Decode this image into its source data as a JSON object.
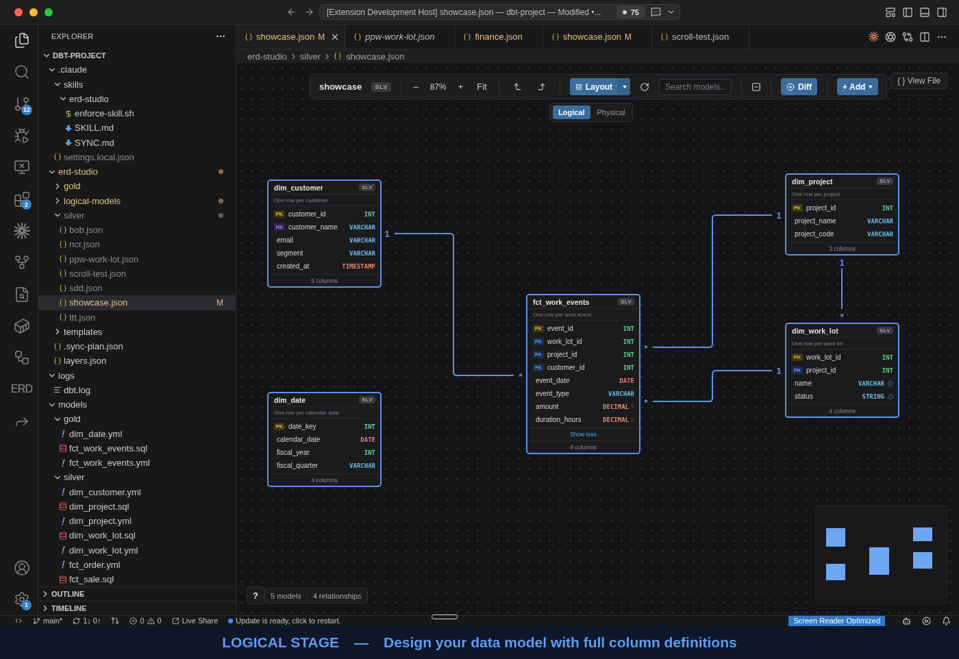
{
  "window": {
    "title": "[Extension Development Host] showcase.json — dbt-project — Modified •...",
    "count": "75"
  },
  "activity_bar": {
    "top": [
      {
        "kind": "files",
        "selected": true
      },
      {
        "kind": "search",
        "selected": false
      },
      {
        "kind": "source_control",
        "selected": false,
        "badge": "12"
      },
      {
        "kind": "run_debug",
        "selected": false
      },
      {
        "kind": "remote",
        "selected": false
      },
      {
        "kind": "extensions",
        "selected": false,
        "badge": "2"
      },
      {
        "kind": "starburst",
        "selected": false
      },
      {
        "kind": "git_graph",
        "selected": false
      },
      {
        "kind": "file_search",
        "selected": false
      },
      {
        "kind": "container",
        "selected": false
      },
      {
        "kind": "diagram",
        "selected": false
      },
      {
        "kind": "text",
        "label": "ERD",
        "selected": false
      },
      {
        "kind": "share",
        "selected": false
      }
    ],
    "bottom": [
      {
        "kind": "account",
        "selected": false
      },
      {
        "kind": "settings",
        "selected": false,
        "badge": "1"
      }
    ]
  },
  "sidebar": {
    "title": "EXPLORER",
    "tree": [
      {
        "label": "DBT-PROJECT",
        "kind": "root",
        "expanded": true,
        "selected": false,
        "children": [
          {
            "label": ".claude",
            "kind": "folder",
            "expanded": true,
            "selected": false,
            "children": [
              {
                "label": "skills",
                "kind": "folder",
                "expanded": true,
                "selected": false,
                "children": [
                  {
                    "label": "erd-studio",
                    "kind": "folder",
                    "expanded": true,
                    "selected": false,
                    "children": [
                      {
                        "label": "enforce-skill.sh",
                        "kind": "shell",
                        "selected": false
                      },
                      {
                        "label": "SKILL.md",
                        "kind": "markdown",
                        "selected": false
                      },
                      {
                        "label": "SYNC.md",
                        "kind": "markdown",
                        "selected": false
                      }
                    ]
                  }
                ]
              },
              {
                "label": "settings.local.json",
                "kind": "json",
                "color": "#8c8c8c",
                "selected": false
              }
            ]
          },
          {
            "label": "erd-studio",
            "kind": "folder",
            "expanded": true,
            "color": "#e2c08d",
            "dot": {
              "color": "#8a6a4c"
            },
            "selected": false,
            "children": [
              {
                "label": "gold",
                "kind": "folder",
                "expanded": false,
                "color": "#e2c08d",
                "selected": false
              },
              {
                "label": "logical-models",
                "kind": "folder",
                "expanded": false,
                "color": "#e2c08d",
                "dot": {
                  "color": "#8a6a4c"
                },
                "selected": false
              },
              {
                "label": "silver",
                "kind": "folder",
                "expanded": true,
                "color": "#8c8c8c",
                "dot": {
                  "color": "#5e5e5e"
                },
                "selected": false,
                "children": [
                  {
                    "label": "bob.json",
                    "kind": "json",
                    "color": "#8c8c8c",
                    "selected": false
                  },
                  {
                    "label": "ncr.json",
                    "kind": "json",
                    "color": "#8c8c8c",
                    "selected": false
                  },
                  {
                    "label": "ppw-work-lot.json",
                    "kind": "json",
                    "color": "#8c8c8c",
                    "selected": false
                  },
                  {
                    "label": "scroll-test.json",
                    "kind": "json",
                    "color": "#8c8c8c",
                    "selected": false
                  },
                  {
                    "label": "sdd.json",
                    "kind": "json",
                    "color": "#8c8c8c",
                    "selected": false
                  },
                  {
                    "label": "showcase.json",
                    "kind": "json",
                    "color": "#e2c08d",
                    "badge": "M",
                    "selected": true
                  },
                  {
                    "label": "ttt.json",
                    "kind": "json",
                    "color": "#8c8c8c",
                    "selected": false
                  }
                ]
              },
              {
                "label": "templates",
                "kind": "folder",
                "expanded": false,
                "selected": false
              },
              {
                "label": ".sync-plan.json",
                "kind": "json",
                "selected": false
              },
              {
                "label": "layers.json",
                "kind": "json",
                "selected": false
              }
            ]
          },
          {
            "label": "logs",
            "kind": "folder",
            "expanded": true,
            "selected": false,
            "children": [
              {
                "label": "dbt.log",
                "kind": "log",
                "selected": false
              }
            ]
          },
          {
            "label": "models",
            "kind": "folder",
            "expanded": true,
            "selected": false,
            "children": [
              {
                "label": "gold",
                "kind": "folder",
                "expanded": true,
                "selected": false,
                "children": [
                  {
                    "label": "dim_date.yml",
                    "kind": "yaml",
                    "selected": false
                  },
                  {
                    "label": "fct_work_events.sql",
                    "kind": "sql",
                    "selected": false
                  },
                  {
                    "label": "fct_work_events.yml",
                    "kind": "yaml",
                    "selected": false
                  }
                ]
              },
              {
                "label": "silver",
                "kind": "folder",
                "expanded": true,
                "selected": false,
                "children": [
                  {
                    "label": "dim_customer.yml",
                    "kind": "yaml",
                    "selected": false
                  },
                  {
                    "label": "dim_project.sql",
                    "kind": "sql",
                    "selected": false
                  },
                  {
                    "label": "dim_project.yml",
                    "kind": "yaml",
                    "selected": false
                  },
                  {
                    "label": "dim_work_lot.sql",
                    "kind": "sql",
                    "selected": false
                  },
                  {
                    "label": "dim_work_lot.yml",
                    "kind": "yaml",
                    "selected": false
                  },
                  {
                    "label": "fct_order.yml",
                    "kind": "yaml",
                    "selected": false
                  },
                  {
                    "label": "fct_sale.sql",
                    "kind": "sql",
                    "selected": false
                  }
                ]
              }
            ]
          }
        ]
      }
    ],
    "sections": [
      {
        "label": "OUTLINE",
        "expanded": false
      },
      {
        "label": "TIMELINE",
        "expanded": false
      }
    ]
  },
  "tabs": [
    {
      "label": "showcase.json",
      "color": "#e2c08d",
      "badge": "M",
      "preview": false,
      "selected": true
    },
    {
      "label": "ppw-work-lot.json",
      "preview": true,
      "selected": false
    },
    {
      "label": "finance.json",
      "color": "#e2c08d",
      "preview": false,
      "selected": false
    },
    {
      "label": "showcase.json",
      "color": "#e2c08d",
      "badge": "M",
      "preview": false,
      "selected": false
    },
    {
      "label": "scroll-test.json",
      "preview": false,
      "selected": false
    }
  ],
  "breadcrumb": [
    "erd-studio",
    "silver",
    "showcase.json"
  ],
  "erd": {
    "toolbar": {
      "model": "showcase",
      "layer": "SLV",
      "zoom_out": "–",
      "zoom": "87%",
      "zoom_in": "+",
      "fit": "Fit",
      "layout": "Layout",
      "search_placeholder": "Search models...",
      "diff": "Diff",
      "add": "+ Add"
    },
    "view_file": "{ } View File",
    "modes": [
      {
        "label": "Logical",
        "selected": true
      },
      {
        "label": "Physical",
        "selected": false
      }
    ],
    "tables": [
      {
        "name": "dim_customer",
        "layer": "SLV",
        "description": "One row per customer",
        "columns": [
          {
            "key": {
              "label": "PK",
              "kind": "primary"
            },
            "name": "customer_id",
            "type": "INT",
            "color": "#5fd08f"
          },
          {
            "key": {
              "label": "NK",
              "kind": "natural"
            },
            "name": "customer_name",
            "type": "VARCHAR",
            "color": "#6cb6dc"
          },
          {
            "name": "email",
            "type": "VARCHAR",
            "color": "#6cb6dc"
          },
          {
            "name": "segment",
            "type": "VARCHAR",
            "color": "#6cb6dc"
          },
          {
            "name": "created_at",
            "type": "TIMESTAMP",
            "color": "#e5846a"
          }
        ],
        "footer": "5 columns"
      },
      {
        "name": "dim_date",
        "layer": "SLV",
        "description": "One row per calendar date",
        "columns": [
          {
            "key": {
              "label": "PK",
              "kind": "primary"
            },
            "name": "date_key",
            "type": "INT",
            "color": "#5fd08f"
          },
          {
            "name": "calendar_date",
            "type": "DATE",
            "color": "#e77b7b"
          },
          {
            "name": "fiscal_year",
            "type": "INT",
            "color": "#5fd08f"
          },
          {
            "name": "fiscal_quarter",
            "type": "VARCHAR",
            "color": "#6cb6dc"
          }
        ],
        "footer": "4 columns"
      },
      {
        "name": "fct_work_events",
        "layer": "SLV",
        "description": "One row per work event",
        "columns": [
          {
            "key": {
              "label": "PK",
              "kind": "primary"
            },
            "name": "event_id",
            "type": "INT",
            "color": "#5fd08f"
          },
          {
            "key": {
              "label": "FK",
              "kind": "foreign"
            },
            "name": "work_lot_id",
            "type": "INT",
            "color": "#5fd08f"
          },
          {
            "key": {
              "label": "FK",
              "kind": "foreign"
            },
            "name": "project_id",
            "type": "INT",
            "color": "#5fd08f"
          },
          {
            "key": {
              "label": "FK",
              "kind": "foreign"
            },
            "name": "customer_id",
            "type": "INT",
            "color": "#5fd08f"
          },
          {
            "name": "event_date",
            "type": "DATE",
            "color": "#e77b7b"
          },
          {
            "name": "event_type",
            "type": "VARCHAR",
            "color": "#6cb6dc"
          },
          {
            "name": "amount",
            "type": "DECIMAL",
            "color": "#e08a6a",
            "suffix": "Σ"
          },
          {
            "name": "duration_hours",
            "type": "DECIMAL",
            "color": "#e08a6a",
            "suffix": "Σ"
          }
        ],
        "toggle": "Show less",
        "footer": "8 columns"
      },
      {
        "name": "dim_project",
        "layer": "SLV",
        "description": "One row per project",
        "columns": [
          {
            "key": {
              "label": "PK",
              "kind": "primary"
            },
            "name": "project_id",
            "type": "INT",
            "color": "#5fd08f"
          },
          {
            "name": "project_name",
            "type": "VARCHAR",
            "color": "#6cb6dc"
          },
          {
            "name": "project_code",
            "type": "VARCHAR",
            "color": "#6cb6dc"
          }
        ],
        "footer": "3 columns"
      },
      {
        "name": "dim_work_lot",
        "layer": "SLV",
        "description": "One row per work lot",
        "columns": [
          {
            "key": {
              "label": "PK",
              "kind": "primary"
            },
            "name": "work_lot_id",
            "type": "INT",
            "color": "#5fd08f"
          },
          {
            "key": {
              "label": "FK",
              "kind": "foreign"
            },
            "name": "project_id",
            "type": "INT",
            "color": "#5fd08f"
          },
          {
            "name": "name",
            "type": "VARCHAR",
            "color": "#6cb6dc",
            "note": true
          },
          {
            "name": "status",
            "type": "STRING",
            "color": "#6cb6dc",
            "note": true
          }
        ],
        "footer": "4 columns"
      }
    ],
    "relationships": [
      {
        "start": "1",
        "end": "*"
      },
      {
        "start": "*",
        "end": "1"
      },
      {
        "start": "*",
        "end": "1"
      },
      {
        "start": "1",
        "end": "*"
      }
    ],
    "help": "?",
    "stats": [
      "5 models",
      "4 relationships"
    ]
  },
  "status_bar": {
    "branch": "main*",
    "sync": "1↓ 0↑",
    "errors": "0",
    "warnings": "0",
    "live_share": "Live Share",
    "notice": "Update is ready, click to restart.",
    "screen_reader": "Screen Reader Optimized"
  },
  "caption": {
    "title": "LOGICAL STAGE",
    "separator": "—",
    "text": "Design your data model with full column definitions"
  }
}
